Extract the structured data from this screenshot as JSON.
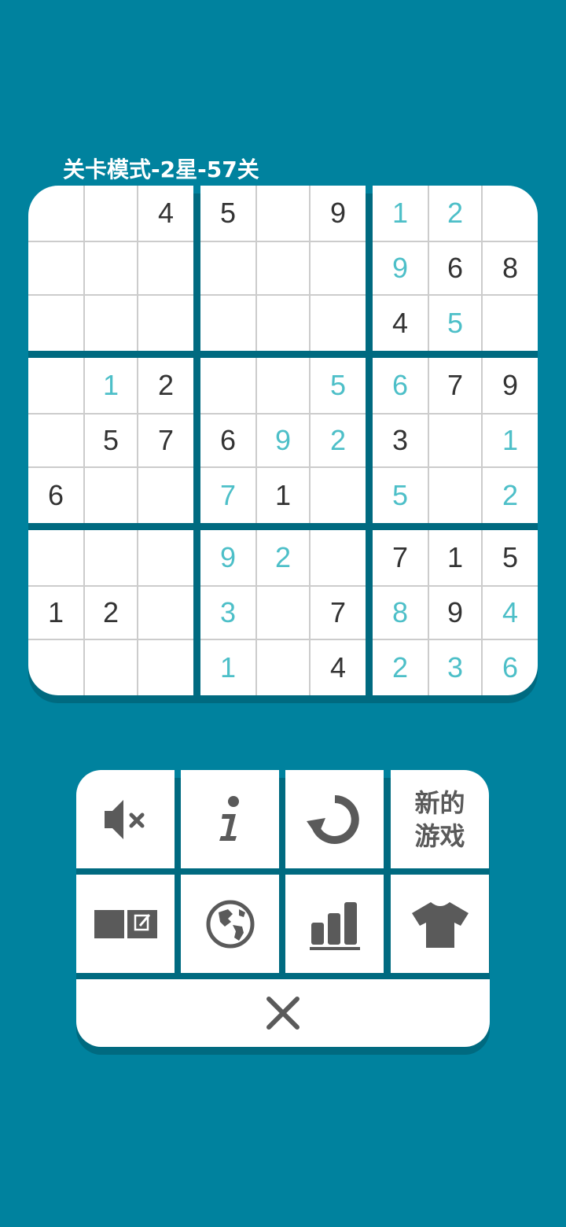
{
  "header": {
    "level_title": "关卡模式-2星-57关"
  },
  "board": {
    "rows": [
      [
        "",
        "",
        "4",
        "5",
        "",
        "9",
        "1",
        "2",
        ""
      ],
      [
        "",
        "",
        "",
        "",
        "",
        "",
        "9",
        "6",
        "8"
      ],
      [
        "",
        "",
        "",
        "",
        "",
        "",
        "4",
        "5",
        ""
      ],
      [
        "",
        "1",
        "2",
        "",
        "",
        "5",
        "6",
        "7",
        "9"
      ],
      [
        "",
        "5",
        "7",
        "6",
        "9",
        "2",
        "3",
        "",
        "1"
      ],
      [
        "6",
        "",
        "",
        "7",
        "1",
        "",
        "5",
        "",
        "2"
      ],
      [
        "",
        "",
        "",
        "9",
        "2",
        "",
        "7",
        "1",
        "5"
      ],
      [
        "1",
        "2",
        "",
        "3",
        "",
        "7",
        "8",
        "9",
        "4"
      ],
      [
        "",
        "",
        "",
        "1",
        "",
        "4",
        "2",
        "3",
        "6"
      ]
    ],
    "entered": [
      [
        0,
        0,
        0,
        0,
        0,
        0,
        1,
        1,
        0
      ],
      [
        0,
        0,
        0,
        0,
        0,
        0,
        1,
        0,
        0
      ],
      [
        0,
        0,
        0,
        0,
        0,
        0,
        0,
        1,
        0
      ],
      [
        0,
        1,
        0,
        0,
        0,
        1,
        1,
        0,
        0
      ],
      [
        0,
        0,
        0,
        0,
        1,
        1,
        0,
        0,
        1
      ],
      [
        0,
        0,
        0,
        1,
        0,
        0,
        1,
        0,
        1
      ],
      [
        0,
        0,
        0,
        1,
        1,
        0,
        0,
        0,
        0
      ],
      [
        0,
        0,
        0,
        1,
        0,
        0,
        1,
        0,
        1
      ],
      [
        0,
        0,
        0,
        1,
        0,
        0,
        1,
        1,
        1
      ]
    ]
  },
  "menu": {
    "new_game_line1": "新的",
    "new_game_line2": "游戏",
    "icons": [
      "sound-muted-icon",
      "info-icon",
      "restart-icon",
      "notes-icon",
      "globe-icon",
      "stats-icon",
      "tshirt-icon",
      "close-icon"
    ]
  },
  "colors": {
    "background": "#00829e",
    "given_digit": "#333333",
    "entered_digit": "#4dbfc8",
    "icon": "#5a5a5a"
  }
}
